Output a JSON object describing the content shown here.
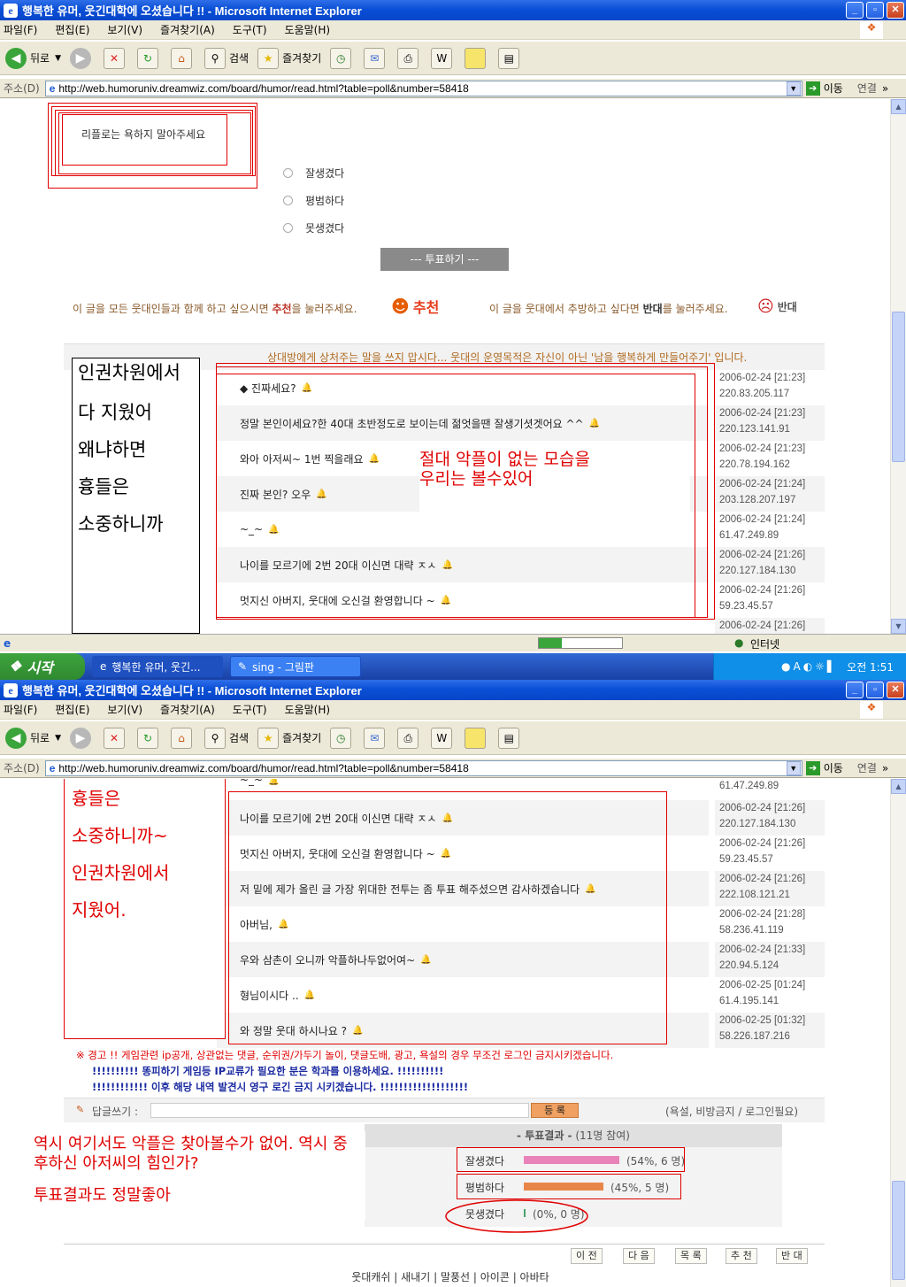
{
  "window": {
    "title": "행복한 유머, 웃긴대학에 오셨습니다 !! - Microsoft Internet Explorer",
    "ie_glyph": "e",
    "controls": {
      "minimize": "_",
      "restore": "▫",
      "close": "✕"
    }
  },
  "menu": [
    "파일(F)",
    "편집(E)",
    "보기(V)",
    "즐겨찾기(A)",
    "도구(T)",
    "도움말(H)"
  ],
  "toolbar": {
    "back": "뒤로",
    "search": "검색",
    "favorites": "즐겨찾기"
  },
  "address": {
    "label": "주소(D)",
    "url": "http://web.humoruniv.dreamwiz.com/board/humor/read.html?table=poll&number=58418",
    "go": "이동",
    "links": "연결",
    "more": "»"
  },
  "status": {
    "zone": "인터넷"
  },
  "taskbar": {
    "start": "시작",
    "tasks": [
      "행복한 유머, 웃긴...",
      "sing - 그림판"
    ],
    "clock": "오전 1:51"
  },
  "top": {
    "notice": "리플로는 욕하지 말아주세요",
    "poll_options": [
      "잘생겼다",
      "평범하다",
      "못생겼다"
    ],
    "vote_button": "--- 투표하기 ---",
    "recommend_prefix": "이 글을 모든 웃대인들과 함께 하고 싶으시면 ",
    "recommend_bold": "추천",
    "recommend_suffix": "을 눌러주세요.",
    "recommend_icon_label": "추천",
    "oppose_prefix": "이 글을 웃대에서 추방하고 싶다면 ",
    "oppose_bold": "반대",
    "oppose_suffix": "를 눌러주세요.",
    "oppose_icon_label": "반대",
    "warning_line": "상대방에게 상처주는 말을 쓰지 맙시다... 웃대의 운영목적은 자신이 아닌 '남을 행복하게 만들어주기' 입니다.",
    "annotation_side": [
      "인권차원에서",
      "다 지웠어",
      "왜냐하면",
      "흉들은",
      "소중하니까"
    ],
    "annotation_center": "절대 악플이 없는 모습을\n우리는 볼수있어",
    "comments": [
      {
        "text": "◆ 진짜세요?",
        "date": "2006-02-24 [21:23]",
        "ip": "220.83.205.117"
      },
      {
        "text": "정말 본인이세요?한 40대 초반정도로 보이는데 젊엇을땐 잘생기셧겟어요 ^^",
        "date": "2006-02-24 [21:23]",
        "ip": "220.123.141.91"
      },
      {
        "text": "와아 아저씨~ 1번 찍을래요",
        "date": "2006-02-24 [21:23]",
        "ip": "220.78.194.162"
      },
      {
        "text": "진짜 본인? 오우",
        "date": "2006-02-24 [21:24]",
        "ip": "203.128.207.197"
      },
      {
        "text": "~_~",
        "date": "2006-02-24 [21:24]",
        "ip": "61.47.249.89"
      },
      {
        "text": "나이를 모르기에 2번 20대 이신면 대략 ㅈㅅ",
        "date": "2006-02-24 [21:26]",
        "ip": "220.127.184.130"
      },
      {
        "text": "멋지신 아버지, 웃대에 오신걸 환영합니다 ~",
        "date": "2006-02-24 [21:26]",
        "ip": "59.23.45.57"
      }
    ],
    "last_date": "2006-02-24 [21:26]"
  },
  "bottom": {
    "cut_text": "~_~",
    "cut_ip": "61.47.249.89",
    "annotation_side": [
      "흉들은",
      "소중하니까~",
      "인권차원에서",
      "지웠어."
    ],
    "comments": [
      {
        "text": "나이를 모르기에 2번 20대 이신면 대략 ㅈㅅ",
        "date": "2006-02-24 [21:26]",
        "ip": "220.127.184.130"
      },
      {
        "text": "멋지신 아버지, 웃대에 오신걸 환영합니다 ~",
        "date": "2006-02-24 [21:26]",
        "ip": "59.23.45.57"
      },
      {
        "text": "저 밑에 제가 올린 글 가장 위대한 전투는 좀 투표 해주셨으면 감사하겠습니다",
        "date": "2006-02-24 [21:26]",
        "ip": "222.108.121.21"
      },
      {
        "text": "아버님,",
        "date": "2006-02-24 [21:28]",
        "ip": "58.236.41.119"
      },
      {
        "text": "우와 삼촌이 오니까 악플하나두없어여~",
        "date": "2006-02-24 [21:33]",
        "ip": "220.94.5.124"
      },
      {
        "text": "형님이시다 ..",
        "date": "2006-02-25 [01:24]",
        "ip": "61.4.195.141"
      },
      {
        "text": "와 정말 웃대 하시나요 ?",
        "date": "2006-02-25 [01:32]",
        "ip": "58.226.187.216"
      }
    ],
    "warn1": "※ 경고 !! 게임관련 ip공개, 상관없는 댓글, 순위권/가두기 놀이, 댓글도배, 광고, 욕설의 경우 무조건 로그인 금지시키겠습니다.",
    "warn2": "!!!!!!!!!! 똥피하기 게임등 IP교류가 필요한 분은 학과를 이용하세요. !!!!!!!!!!",
    "warn3": "!!!!!!!!!!!! 이후 해당 내역 발견시 영구 로긴 금지 시키겠습니다. !!!!!!!!!!!!!!!!!!!",
    "reply_label": "답글쓰기 :",
    "reply_button": "등 록",
    "reply_note": "(욕설, 비방금지 / 로그인필요)",
    "poll_title": "- 투표결과 -",
    "poll_count": "(11명 참여)",
    "poll_results": [
      {
        "label": "잘생겼다",
        "result": "(54%, 6 명)",
        "fraction": 0.54,
        "color": "#e982b9"
      },
      {
        "label": "평범하다",
        "result": "(45%, 5 명)",
        "fraction": 0.45,
        "color": "#e8864a"
      },
      {
        "label": "못생겼다",
        "result": "(0%, 0 명)",
        "fraction": 0.0,
        "color": "#4aa36a"
      }
    ],
    "annotation_poll": "역시 여기서도 악플은 찾아볼수가 없어. 역시 중후하신 아저씨의 힘인가?",
    "annotation_poll2": "투표결과도 정말좋아",
    "nav": [
      "이 전",
      "다 음",
      "목 록",
      "추 천",
      "반 대"
    ],
    "footer_links": [
      "웃대캐쉬",
      "새내기",
      "말풍선",
      "아이콘",
      "아바타"
    ]
  }
}
